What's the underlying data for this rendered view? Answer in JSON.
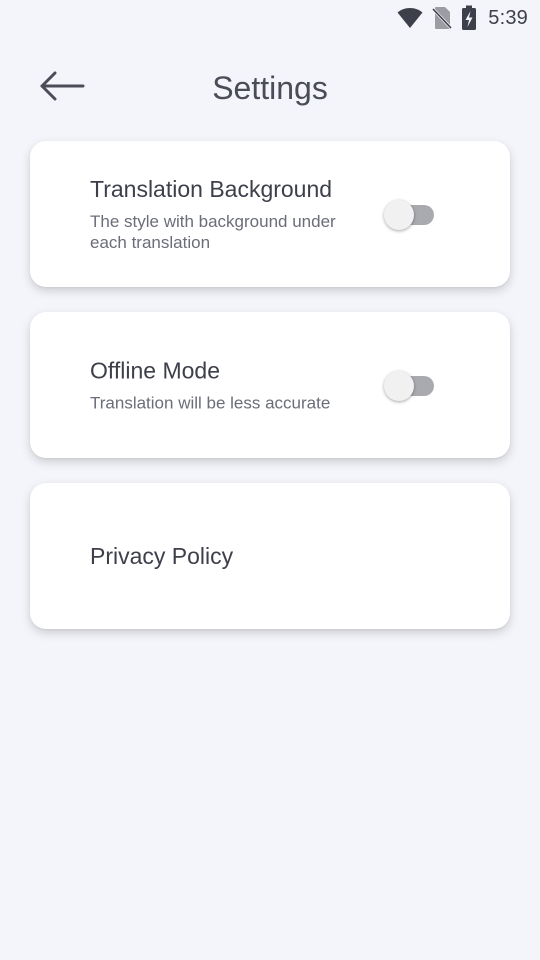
{
  "status_bar": {
    "time": "5:39",
    "icons": [
      "wifi-icon",
      "no-sim-icon",
      "battery-charging-icon"
    ]
  },
  "app_bar": {
    "title": "Settings",
    "back_icon": "arrow-left-icon"
  },
  "settings": [
    {
      "title": "Translation Background",
      "description": "The style with background under each translation",
      "toggle_on": false
    },
    {
      "title": "Offline Mode",
      "description": "Translation will be less accurate",
      "toggle_on": false
    },
    {
      "title": "Privacy Policy"
    }
  ],
  "colors": {
    "background": "#f4f5fa",
    "card": "#ffffff",
    "text_primary": "#3d3f4a",
    "text_secondary": "#6b6d78",
    "toggle_track_off": "#a9aab0",
    "toggle_thumb_off": "#f1f1f1"
  }
}
